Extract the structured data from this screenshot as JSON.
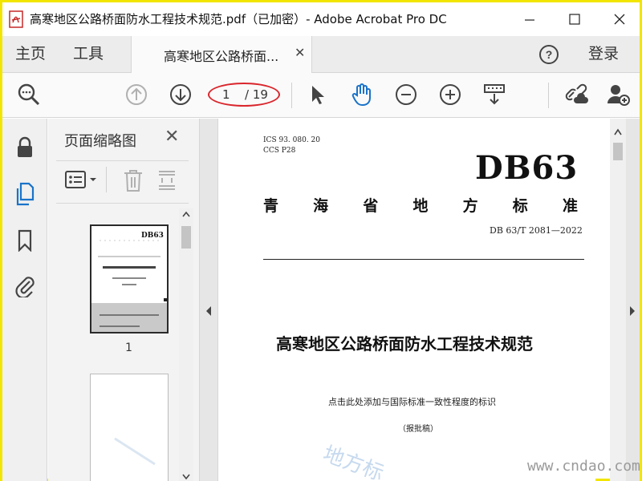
{
  "window": {
    "title": "高寒地区公路桥面防水工程技术规范.pdf（已加密）- Adobe Acrobat Pro DC"
  },
  "nav": {
    "home": "主页",
    "tools": "工具",
    "doc_tab": "高寒地区公路桥面...",
    "login": "登录"
  },
  "toolbar": {
    "current_page": "1",
    "total_pages": "/ 19"
  },
  "thumbnails": {
    "title": "页面缩略图",
    "page_label": "1"
  },
  "document": {
    "ics": "ICS   93. 080. 20",
    "ccs": "CCS   P28",
    "code": "DB63",
    "province_chars": [
      "青",
      "海",
      "省",
      "地",
      "方",
      "标",
      "准"
    ],
    "standard_number": "DB 63/T  2081—2022",
    "title": "高寒地区公路桥面防水工程技术规范",
    "consistency_note": "点击此处添加与国际标准一致性程度的标识",
    "draft": "（报批稿）",
    "watermark": "地方标"
  },
  "overlay": {
    "site_watermark": "www.cndao.com"
  },
  "colors": {
    "accent_blue": "#1a73c9",
    "highlight_red": "#d9262c",
    "window_border": "#f2e600"
  }
}
